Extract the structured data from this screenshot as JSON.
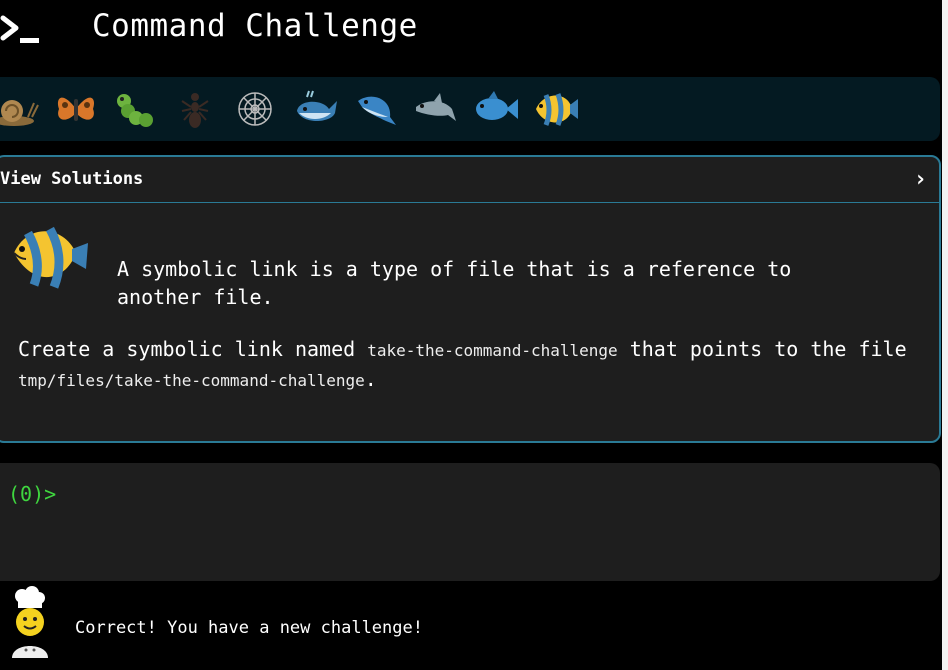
{
  "header": {
    "title": "Command Challenge",
    "logo_icon": "terminal-prompt-icon"
  },
  "levels": {
    "icons": [
      "snail-icon",
      "butterfly-icon",
      "caterpillar-icon",
      "ant-icon",
      "spider-web-icon",
      "whale-icon",
      "dolphin-icon",
      "dolphin-icon",
      "fish-icon",
      "tropical-fish-icon"
    ],
    "current": "tropical-fish-icon"
  },
  "solutions": {
    "label": "View Solutions",
    "chevron": "›",
    "intro": "A symbolic link is a type of file that is a reference to another file.",
    "task_prefix": "Create a symbolic link named ",
    "task_link_name": "take-the-command-challenge",
    "task_middle": " that points to the file ",
    "task_target": "tmp/files/take-the-command-challenge",
    "task_suffix": "."
  },
  "terminal": {
    "prompt": "(0)>"
  },
  "status": {
    "message": "Correct! You have a new challenge!",
    "avatar_icon": "chef-icon"
  },
  "colors": {
    "accent": "#2a7a95",
    "prompt": "#3fd63f",
    "panel": "#1e1e1e",
    "level_bar": "#041a22"
  }
}
